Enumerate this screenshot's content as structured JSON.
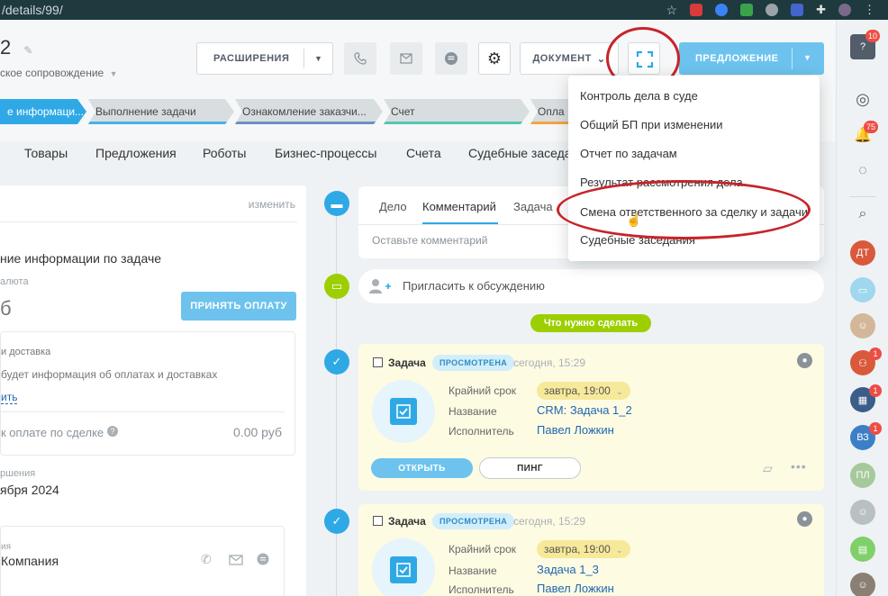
{
  "browser": {
    "url": "/details/99/"
  },
  "deal": {
    "title": "2",
    "subtitle": "ское сопровождение"
  },
  "toolbar": {
    "extensions_label": "РАСШИРЕНИЯ",
    "document_label": "ДОКУМЕНТ",
    "offer_label": "ПРЕДЛОЖЕНИЕ"
  },
  "stages": [
    {
      "label": "е информаци..."
    },
    {
      "label": "Выполнение задачи"
    },
    {
      "label": "Ознакомление заказчи..."
    },
    {
      "label": "Счет"
    },
    {
      "label": "Опла"
    }
  ],
  "tabs": [
    "Товары",
    "Предложения",
    "Роботы",
    "Бизнес-процессы",
    "Счета",
    "Судебные заседа"
  ],
  "left": {
    "edit_link": "изменить",
    "section_title": "ние информации по задаче",
    "currency_label": "алюта",
    "amount_fragment": "б",
    "accept_payment": "ПРИНЯТЬ ОПЛАТУ",
    "payment_delivery_title": "и доставка",
    "payment_delivery_desc": "будет информация об оплатах и доставках",
    "payment_delivery_link": "ить",
    "to_pay_label": "к оплате по сделке",
    "to_pay_value": "0.00 руб",
    "completion_label": "ршения",
    "completion_date": "ября 2024",
    "client_label": "ия",
    "client_name": "Компания"
  },
  "composer": {
    "tabs": [
      "Дело",
      "Комментарий",
      "Задача"
    ],
    "placeholder": "Оставьте комментарий"
  },
  "invite": {
    "label": "Пригласить к обсуждению"
  },
  "todo_label": "Что нужно сделать",
  "tasks": [
    {
      "type": "Задача",
      "status": "ПРОСМОТРЕНА",
      "time": "сегодня, 15:29",
      "deadline_label": "Крайний срок",
      "deadline": "завтра, 19:00",
      "name_label": "Название",
      "name": "CRM: Задача 1_2",
      "assignee_label": "Исполнитель",
      "assignee": "Павел Ложкин",
      "open_label": "ОТКРЫТЬ",
      "ping_label": "ПИНГ"
    },
    {
      "type": "Задача",
      "status": "ПРОСМОТРЕНА",
      "time": "сегодня, 15:29",
      "deadline_label": "Крайний срок",
      "deadline": "завтра, 19:00",
      "name_label": "Название",
      "name": "Задача 1_3",
      "assignee_label": "Исполнитель",
      "assignee": "Павел Ложкин"
    }
  ],
  "document_menu": [
    "Контроль дела в суде",
    "Общий БП при изменении",
    "Отчет по задачам",
    "Результат рассмотрения дела",
    "Смена ответственного за сделку и задачи",
    "Судебные заседания"
  ],
  "rail": {
    "help_badge": "10",
    "notif_badge": "75",
    "avatars": [
      "ДТ",
      "ВЗ",
      "ПЛ"
    ],
    "badge_one": "1"
  },
  "colors": {
    "accent": "#2fa9e6",
    "button_blue": "#6dc3ee",
    "annotation_red": "#c7242a",
    "task_bg": "#fefbe3"
  }
}
